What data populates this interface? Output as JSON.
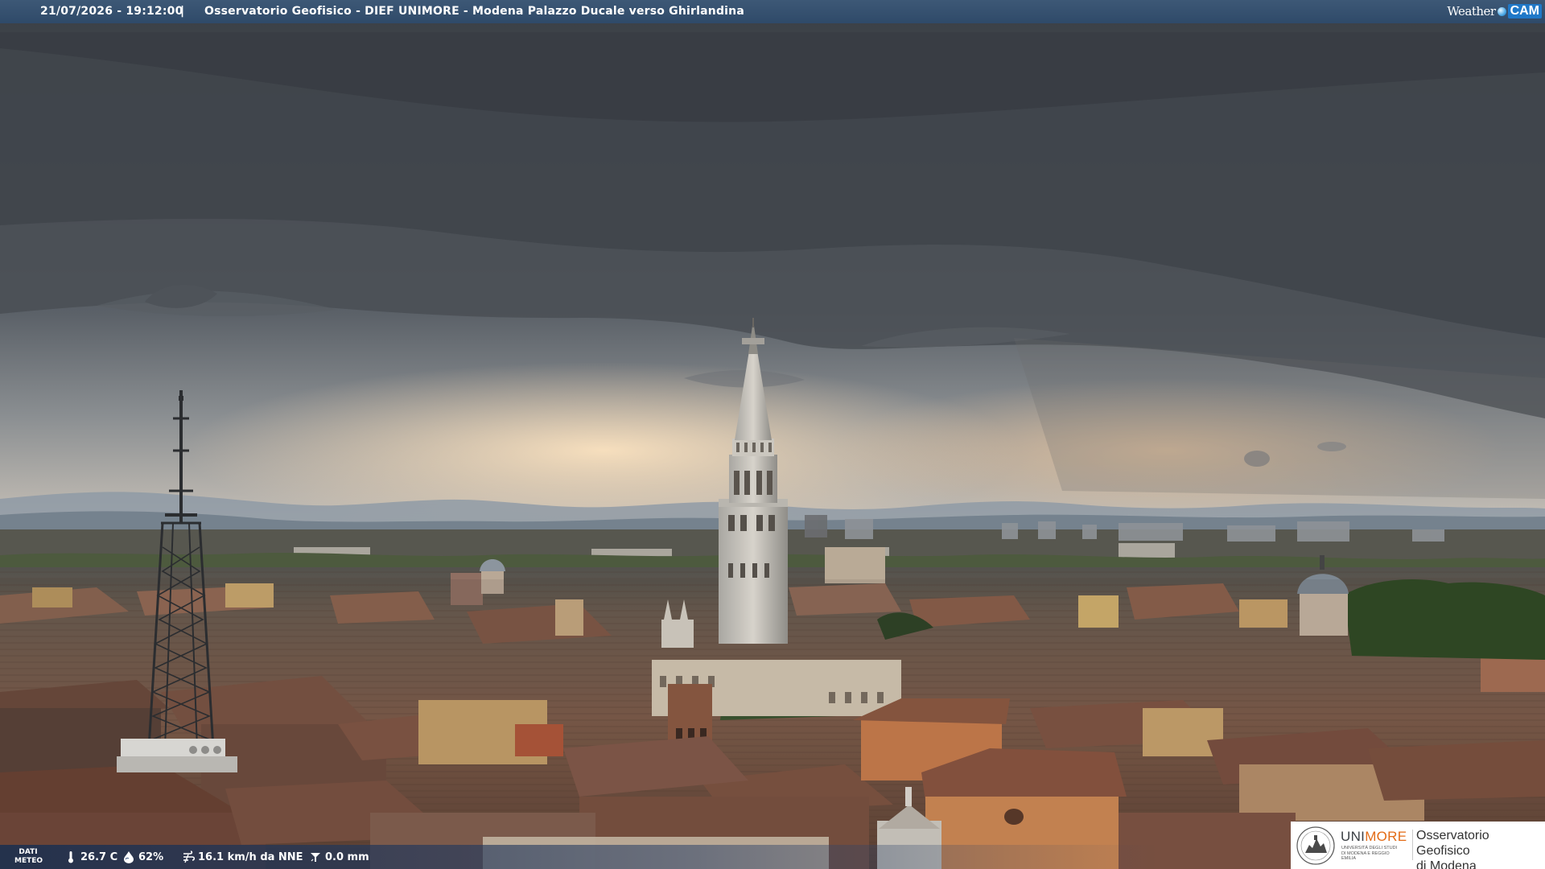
{
  "header": {
    "timestamp": "21/07/2026 - 19:12:00",
    "separator": "|",
    "title": "Osservatorio Geofisico - DIEF UNIMORE - Modena Palazzo Ducale verso Ghirlandina"
  },
  "logo": {
    "weather_text": "Weather",
    "cam_text": "CAM"
  },
  "meteo": {
    "label_line1": "DATI",
    "label_line2": "METEO",
    "temperature": "26.7 C",
    "humidity": "62%",
    "wind": "16.1 km/h da NNE",
    "rain": "0.0 mm",
    "icons": [
      "thermometer-icon",
      "humidity-drop-icon",
      "wind-icon",
      "rain-gauge-icon"
    ]
  },
  "institution": {
    "name_part1": "UNI",
    "name_part2": "MORE",
    "subtitle": "Università degli Studi di Modena e Reggio Emilia",
    "observatory_line1": "Osservatorio Geofisico",
    "observatory_line2": "di Modena"
  },
  "colors": {
    "top_bar": "#34506f",
    "accent_orange": "#e36b16",
    "sky_dark": "#3c4248",
    "horizon_glow": "#f2d9b8",
    "roof_terracotta": "#8a5a45"
  }
}
